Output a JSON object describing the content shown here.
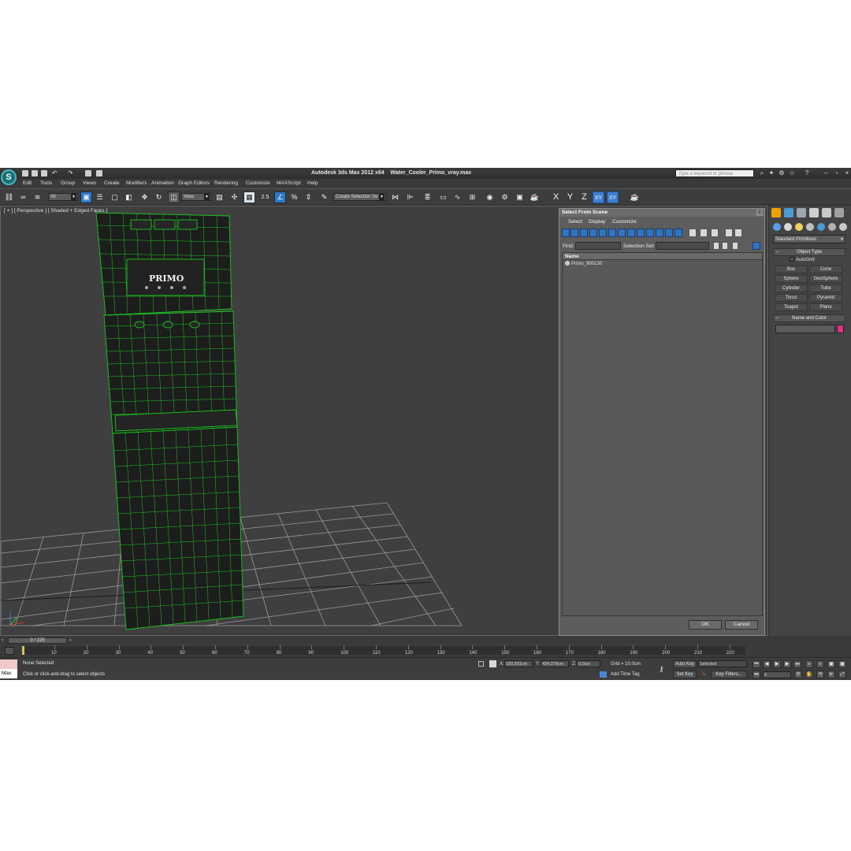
{
  "app": {
    "title_app": "Autodesk 3ds Max  2012 x64",
    "title_file": "Water_Cooler_Primo_vray.max",
    "logo_glyph": "S",
    "search_placeholder": "Type a keyword or phrase"
  },
  "menu": [
    "Edit",
    "Tools",
    "Group",
    "Views",
    "Create",
    "Modifiers",
    "Animation",
    "Graph Editors",
    "Rendering",
    "Customize",
    "MAXScript",
    "Help"
  ],
  "toolbar": {
    "filter_value": "All",
    "refcoord_value": "View",
    "snap_angle_label": "2.5",
    "named_sel_value": "Create Selection Se",
    "axes": [
      "X",
      "Y",
      "Z",
      "XY",
      "XY"
    ]
  },
  "viewport": {
    "label": "[ + ] [ Perspective ] [ Shaded + Edged Faces ]",
    "brand_text": "PRIMO",
    "wire_color": "#18c81e"
  },
  "dialog": {
    "title": "Select From Scene",
    "close_glyph": "x",
    "menu": [
      "Select",
      "Display",
      "Customize"
    ],
    "find_label": "Find:",
    "selection_set_label": "Selection Set:",
    "column_name": "Name",
    "items": [
      "Primo_900130"
    ],
    "ok_label": "OK",
    "cancel_label": "Cancel"
  },
  "command_panel": {
    "category": "Standard Primitives",
    "object_type_title": "Object Type",
    "autogrid_label": "AutoGrid",
    "primitives": [
      "Box",
      "Cone",
      "Sphere",
      "GeoSphere",
      "Cylinder",
      "Tube",
      "Torus",
      "Pyramid",
      "Teapot",
      "Plane"
    ],
    "name_color_title": "Name and Color",
    "swatch_color": "#e0307e"
  },
  "timeline": {
    "slider_label": "0 / 225",
    "ticks": [
      "10",
      "20",
      "30",
      "40",
      "50",
      "60",
      "70",
      "80",
      "90",
      "100",
      "110",
      "120",
      "130",
      "140",
      "150",
      "160",
      "170",
      "180",
      "190",
      "200",
      "210",
      "220"
    ]
  },
  "status": {
    "maxscript_label": "Max",
    "selection_status": "None Selected",
    "prompt": "Click or click-and-drag to select objects",
    "x_label": "X:",
    "x_value": "320,931cm",
    "y_label": "Y:",
    "y_value": "434,279cm",
    "z_label": "Z:",
    "z_value": "0,0cm",
    "grid": "Grid = 10,0cm",
    "add_time_tag": "Add Time Tag",
    "auto_key": "Auto Key",
    "selected_value": "Selected",
    "set_key": "Set Key",
    "key_filters": "Key Filters...",
    "frame_value": "0"
  }
}
